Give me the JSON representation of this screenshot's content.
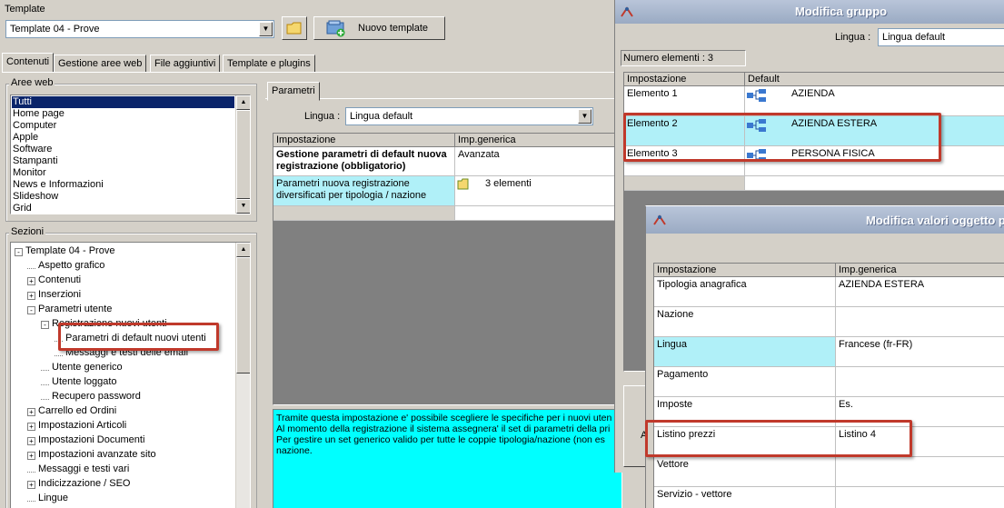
{
  "template": {
    "label": "Template",
    "selected": "Template 04 - Prove",
    "new_button": "Nuovo template"
  },
  "tabs": [
    "Contenuti",
    "Gestione aree web",
    "File aggiuntivi",
    "Template e plugins"
  ],
  "aree_web": {
    "label": "Aree web",
    "items": [
      "Tutti",
      "Home page",
      "Computer",
      "Apple",
      "Software",
      "Stampanti",
      "Monitor",
      "News e Informazioni",
      "Slideshow",
      "Grid"
    ],
    "selected_index": 0
  },
  "sezioni": {
    "label": "Sezioni",
    "items": [
      {
        "label": "Template 04 - Prove",
        "toggle": "-"
      },
      {
        "label": "Aspetto grafico",
        "toggle": ""
      },
      {
        "label": "Contenuti",
        "toggle": "+"
      },
      {
        "label": "Inserzioni",
        "toggle": "+"
      },
      {
        "label": "Parametri utente",
        "toggle": "-"
      },
      {
        "label": "Registrazione nuovi utenti",
        "toggle": "-"
      },
      {
        "label": "Parametri di default nuovi utenti",
        "toggle": ""
      },
      {
        "label": "Messaggi e testi delle email",
        "toggle": ""
      },
      {
        "label": "Utente generico",
        "toggle": ""
      },
      {
        "label": "Utente loggato",
        "toggle": ""
      },
      {
        "label": "Recupero password",
        "toggle": ""
      },
      {
        "label": "Carrello ed Ordini",
        "toggle": "+"
      },
      {
        "label": "Impostazioni Articoli",
        "toggle": "+"
      },
      {
        "label": "Impostazioni Documenti",
        "toggle": "+"
      },
      {
        "label": "Impostazioni avanzate sito",
        "toggle": "+"
      },
      {
        "label": "Messaggi e testi vari",
        "toggle": ""
      },
      {
        "label": "Indicizzazione / SEO",
        "toggle": "+"
      },
      {
        "label": "Lingue",
        "toggle": ""
      }
    ]
  },
  "parametri": {
    "tab": "Parametri",
    "lingua_label": "Lingua :",
    "lingua_value": "Lingua default",
    "columns": [
      "Impostazione",
      "Imp.generica"
    ],
    "rows": [
      {
        "name": "Gestione parametri di default nuova registrazione (obbligatorio)",
        "value": "Avanzata"
      },
      {
        "name": "Parametri nuova registrazione diversificati per tipologia / nazione",
        "value": "3 elementi"
      }
    ],
    "description": "Tramite questa impostazione e' possibile scegliere le specifiche per i nuovi uten\nAl momento della registrazione il sistema assegnera' il set di parametri della pri\nPer gestire un set generico valido per tutte le coppie tipologia/nazione (non es\nnazione."
  },
  "modifica_gruppo": {
    "title": "Modifica gruppo",
    "lingua_label": "Lingua :",
    "lingua_value": "Lingua default",
    "count": "Numero elementi : 3",
    "columns": [
      "Impostazione",
      "Default"
    ],
    "rows": [
      {
        "name": "Elemento 1",
        "value": "AZIENDA"
      },
      {
        "name": "Elemento 2",
        "value": "AZIENDA ESTERA"
      },
      {
        "name": "Elemento 3",
        "value": "PERSONA FISICA"
      }
    ],
    "left_edge_letter": "A"
  },
  "modifica_valori": {
    "title": "Modifica valori oggetto p",
    "columns": [
      "Impostazione",
      "Imp.generica"
    ],
    "rows": [
      {
        "name": "Tipologia anagrafica",
        "value": "AZIENDA ESTERA"
      },
      {
        "name": "Nazione",
        "value": ""
      },
      {
        "name": "Lingua",
        "value": "Francese (fr-FR)"
      },
      {
        "name": "Pagamento",
        "value": ""
      },
      {
        "name": "Imposte",
        "value": "Es."
      },
      {
        "name": "Listino prezzi",
        "value": "Listino 4"
      },
      {
        "name": "Vettore",
        "value": ""
      },
      {
        "name": "Servizio - vettore",
        "value": ""
      }
    ]
  },
  "colors": {
    "selection": "#0a246a",
    "cyan_row": "#b0f0f8",
    "description_bg": "#00ffff",
    "highlight": "#c0392b",
    "dark_area": "#808080"
  }
}
